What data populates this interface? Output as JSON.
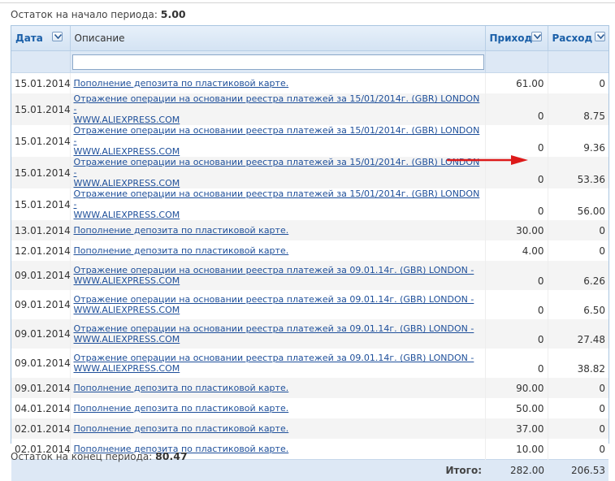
{
  "balance_start": {
    "label": "Остаток на начало периода:",
    "value": "5.00"
  },
  "balance_end": {
    "label": "Остаток на конец периода:",
    "value": "80.47"
  },
  "columns": {
    "date": "Дата",
    "description": "Описание",
    "income": "Приход",
    "expense": "Расход"
  },
  "filter": {
    "value": "",
    "placeholder": ""
  },
  "rows": [
    {
      "date": "15.01.2014",
      "desc1": "Пополнение депозита по пластиковой карте.",
      "desc2": "",
      "income": "61.00",
      "expense": "0"
    },
    {
      "date": "15.01.2014",
      "desc1": "Отражение операции на основании реестра платежей за 15/01/2014г. (GBR) LONDON -",
      "desc2": "WWW.ALIEXPRESS.COM",
      "income": "0",
      "expense": "8.75"
    },
    {
      "date": "15.01.2014",
      "desc1": "Отражение операции на основании реестра платежей за 15/01/2014г. (GBR) LONDON -",
      "desc2": "WWW.ALIEXPRESS.COM",
      "income": "0",
      "expense": "9.36"
    },
    {
      "date": "15.01.2014",
      "desc1": "Отражение операции на основании реестра платежей за 15/01/2014г. (GBR) LONDON -",
      "desc2": "WWW.ALIEXPRESS.COM",
      "income": "0",
      "expense": "53.36"
    },
    {
      "date": "15.01.2014",
      "desc1": "Отражение операции на основании реестра платежей за 15/01/2014г. (GBR) LONDON -",
      "desc2": "WWW.ALIEXPRESS.COM",
      "income": "0",
      "expense": "56.00"
    },
    {
      "date": "13.01.2014",
      "desc1": "Пополнение депозита по пластиковой карте.",
      "desc2": "",
      "income": "30.00",
      "expense": "0"
    },
    {
      "date": "12.01.2014",
      "desc1": "Пополнение депозита по пластиковой карте.",
      "desc2": "",
      "income": "4.00",
      "expense": "0"
    },
    {
      "date": "09.01.2014",
      "desc1": "Отражение операции на основании реестра платежей за 09.01.14г. (GBR) LONDON -",
      "desc2": "WWW.ALIEXPRESS.COM",
      "income": "0",
      "expense": "6.26"
    },
    {
      "date": "09.01.2014",
      "desc1": "Отражение операции на основании реестра платежей за 09.01.14г. (GBR) LONDON -",
      "desc2": "WWW.ALIEXPRESS.COM",
      "income": "0",
      "expense": "6.50"
    },
    {
      "date": "09.01.2014",
      "desc1": "Отражение операции на основании реестра платежей за 09.01.14г. (GBR) LONDON -",
      "desc2": "WWW.ALIEXPRESS.COM",
      "income": "0",
      "expense": "27.48"
    },
    {
      "date": "09.01.2014",
      "desc1": "Отражение операции на основании реестра платежей за 09.01.14г. (GBR) LONDON -",
      "desc2": "WWW.ALIEXPRESS.COM",
      "income": "0",
      "expense": "38.82"
    },
    {
      "date": "09.01.2014",
      "desc1": "Пополнение депозита по пластиковой карте.",
      "desc2": "",
      "income": "90.00",
      "expense": "0"
    },
    {
      "date": "04.01.2014",
      "desc1": "Пополнение депозита по пластиковой карте.",
      "desc2": "",
      "income": "50.00",
      "expense": "0"
    },
    {
      "date": "02.01.2014",
      "desc1": "Пополнение депозита по пластиковой карте.",
      "desc2": "",
      "income": "37.00",
      "expense": "0"
    },
    {
      "date": "02.01.2014",
      "desc1": "Пополнение депозита по пластиковой карте.",
      "desc2": "",
      "income": "10.00",
      "expense": "0"
    }
  ],
  "totals": {
    "label": "Итого:",
    "income": "282.00",
    "expense": "206.53"
  },
  "colors": {
    "accent": "#1a5fa8",
    "link": "#1e4f9a",
    "arrow": "#dd1a1a",
    "header_bg": "#d4e3f3"
  },
  "icons": {
    "sort": "chevron-down-icon",
    "annotation": "red-arrow"
  }
}
